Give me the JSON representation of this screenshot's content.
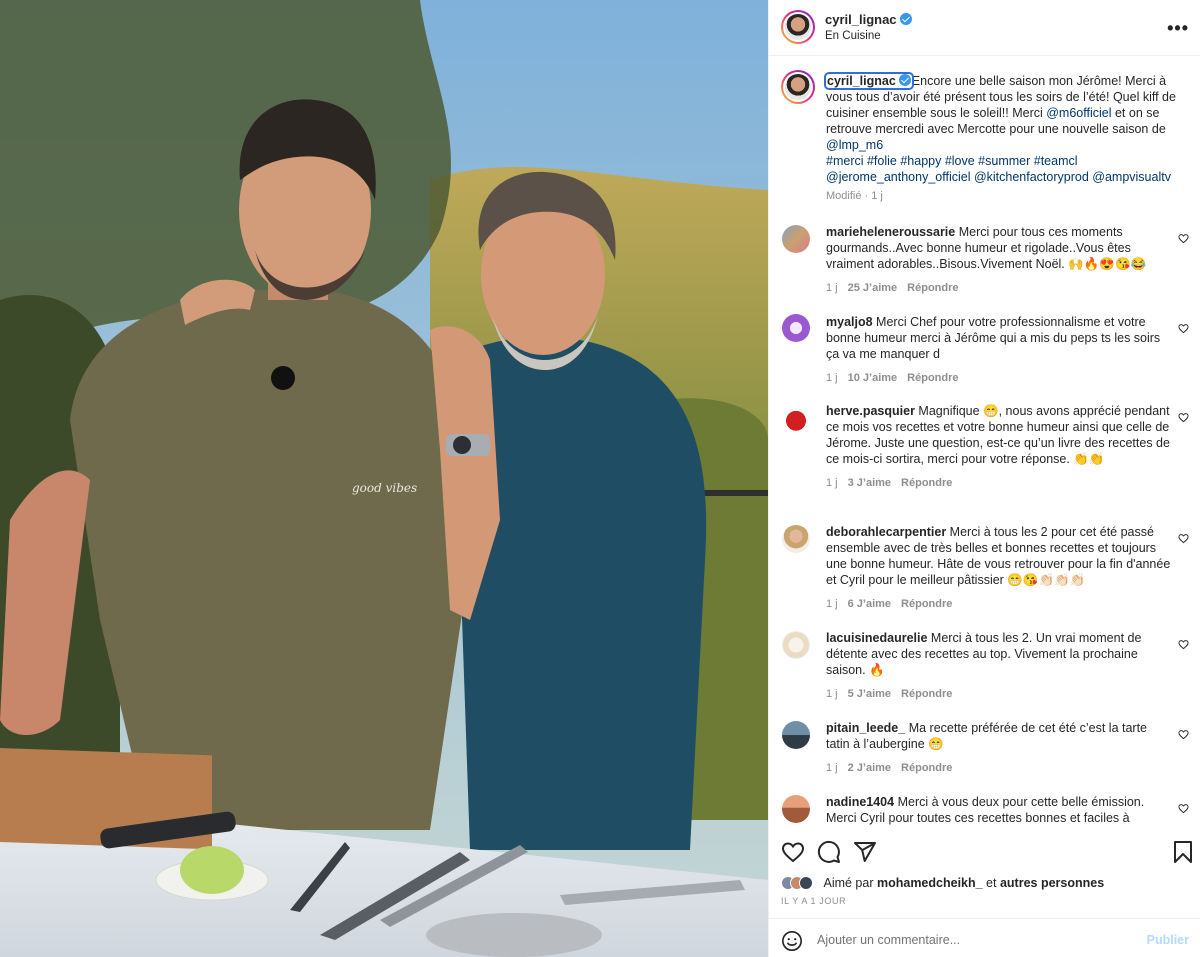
{
  "post": {
    "username": "cyril_lignac",
    "location": "En Cuisine",
    "more_label": "•••",
    "caption_text": "Encore une belle saison mon Jérôme! Merci à vous tous d’avoir été présent tous les soirs de l’été! Quel kiff de cuisiner ensemble sous le soleil!! Merci ",
    "caption_tag1": "@m6officiel",
    "caption_mid": " et on se retrouve mercredi avec Mercotte pour une nouvelle saison de ",
    "caption_tag2": "@lmp_m6",
    "hashtags": "#merci #folie #happy #love #summer #teamcl",
    "mentions": "@jerome_anthony_officiel @kitchenfactoryprod @ampvisualtv",
    "caption_meta": "Modifié · 1 j"
  },
  "comments": [
    {
      "user": "marieheleneroussarie",
      "text": "Merci pour tous ces moments gourmands..Avec bonne humeur et rigolade..Vous êtes vraiment adorables..Bisous.Vivement Noël. 🙌🔥😍😘😂",
      "time": "1 j",
      "likes": "25 J’aime",
      "reply": "Répondre"
    },
    {
      "user": "myaljo8",
      "text": "Merci Chef pour votre professionnalisme et votre bonne humeur merci à Jérôme qui a mis du peps ts les soirs ça va me manquer d",
      "time": "1 j",
      "likes": "10 J’aime",
      "reply": "Répondre"
    },
    {
      "user": "herve.pasquier",
      "text": "Magnifique 😁, nous avons apprécié pendant ce mois vos recettes et votre bonne humeur ainsi que celle de Jérome. Juste une question, est-ce qu’un livre des recettes de ce mois-ci sortira, merci pour votre réponse. 👏👏",
      "time": "1 j",
      "likes": "3 J’aime",
      "reply": "Répondre"
    },
    {
      "user": "deborahlecarpentier",
      "text": "Merci à tous les 2 pour cet été passé ensemble avec de très belles et bonnes recettes et toujours une bonne humeur. Hâte de vous retrouver pour la fin d'année et Cyril pour le meilleur pâtissier 😁😘👏🏻👏🏻👏🏻",
      "time": "1 j",
      "likes": "6 J’aime",
      "reply": "Répondre"
    },
    {
      "user": "lacuisinedaurelie",
      "text": "Merci à tous les 2. Un vrai moment de détente avec des recettes au top. Vivement la prochaine saison. 🔥",
      "time": "1 j",
      "likes": "5 J’aime",
      "reply": "Répondre"
    },
    {
      "user": "pitain_leede_",
      "text": "Ma recette préférée de cet été c’est la tarte tatin à l’aubergine 😁",
      "time": "1 j",
      "likes": "2 J’aime",
      "reply": "Répondre"
    },
    {
      "user": "nadine1404",
      "text": "Merci à vous deux pour cette belle émission. Merci Cyril pour toutes ces recettes bonnes et faciles à",
      "time": "",
      "likes": "",
      "reply": ""
    }
  ],
  "likes": {
    "prefix": "Aimé par ",
    "user": "mohamedcheikh_",
    "mid": " et ",
    "others": "autres personnes"
  },
  "time_ago": "IL Y A 1 JOUR",
  "add_comment": {
    "placeholder": "Ajouter un commentaire...",
    "publish": "Publier"
  },
  "photo": {
    "shirt_text": "good vibes"
  }
}
